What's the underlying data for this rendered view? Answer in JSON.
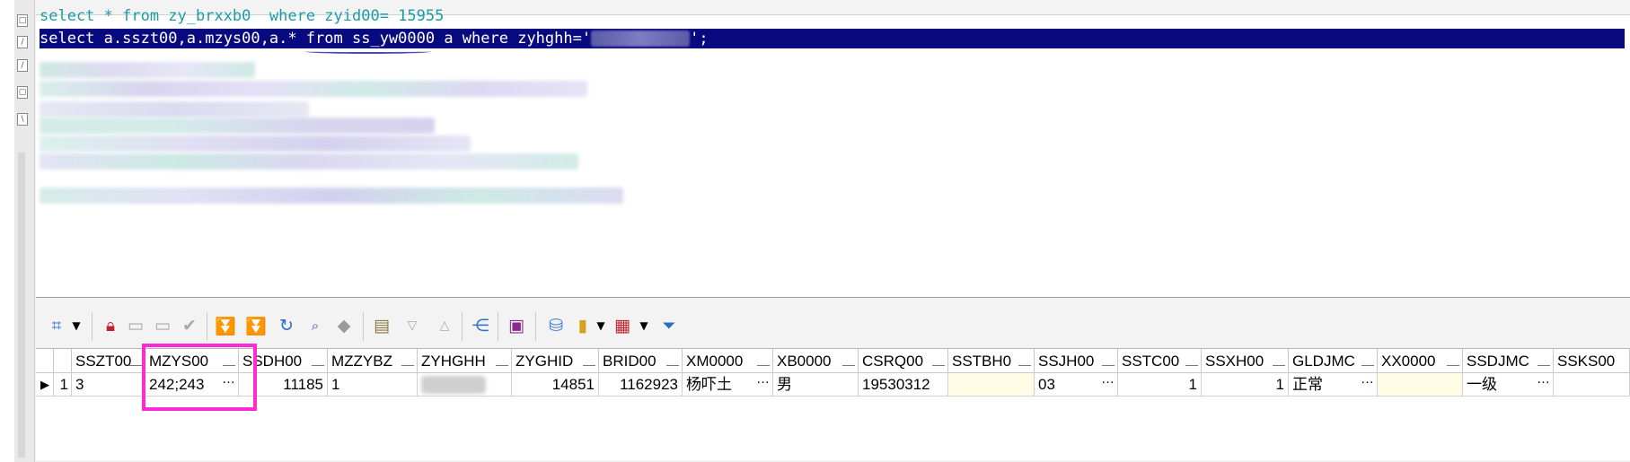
{
  "editor": {
    "prev_line": "select * from zy_brxxb0  where zyid00= 15955",
    "selected_sql_prefix": "select a.sszt00,a.mzys00,a.* from ss_yw0000 a where zyhghh='",
    "selected_sql_suffix": "';"
  },
  "toolbar": {
    "icons": [
      "select-icon",
      "dropdown-arrow-icon",
      "lock-icon",
      "new-record-icon",
      "delete-record-icon",
      "post-icon",
      "first-icon",
      "last-icon",
      "refresh-icon",
      "find-icon",
      "clear-icon",
      "form-view-icon",
      "prev-icon",
      "next-icon",
      "tree-icon",
      "save-icon",
      "db-icon",
      "chart-icon",
      "grid-icon",
      "filter-icon"
    ]
  },
  "grid": {
    "columns": [
      "SSZT00",
      "MZYS00",
      "SSDH00",
      "MZZYBZ",
      "ZYHGHH",
      "ZYGHID",
      "BRID00",
      "XM0000",
      "XB0000",
      "CSRQ00",
      "SSTBH0",
      "SSJH00",
      "SSTC00",
      "SSXH00",
      "GLDJMC",
      "XX0000",
      "SSDJMC",
      "SSKS00"
    ],
    "row": {
      "row_number": "1",
      "SSZT00": "3",
      "MZYS00": "242;243",
      "SSDH00": "11185",
      "MZZYBZ": "1",
      "ZYHGHH": "",
      "ZYGHID": "14851",
      "BRID00": "1162923",
      "XM0000": "杨吓土",
      "XB0000": "男",
      "CSRQ00": "19530312",
      "SSTBH0": "",
      "SSJH00": "03",
      "SSTC00": "1",
      "SSXH00": "1",
      "GLDJMC": "正常",
      "XX0000": "",
      "SSDJMC": "一级",
      "SSKS00": ""
    }
  },
  "colors": {
    "selection": "#0a0a80",
    "highlight": "#ff2ad4",
    "cell_yellow": "#fffbe4"
  }
}
